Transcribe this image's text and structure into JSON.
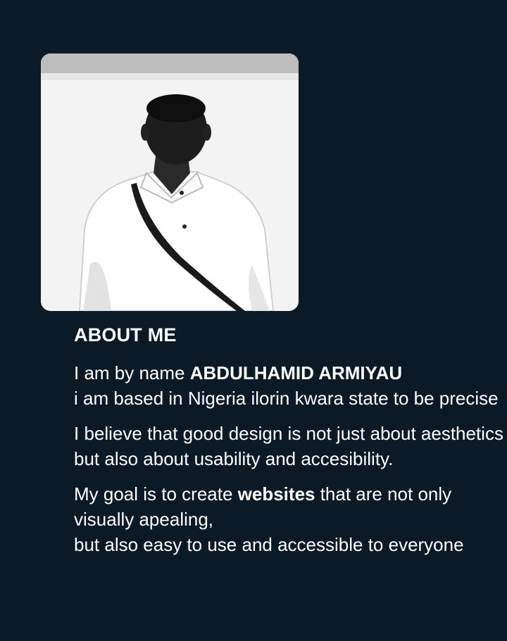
{
  "about": {
    "heading": "ABOUT ME",
    "intro_prefix": "I am by name ",
    "name": "ABDULHAMID ARMIYAU",
    "location": "i am based in Nigeria ilorin kwara state to be precise",
    "belief": "I believe that good design is not just about aesthetics but also about usability and accesibility.",
    "goal_prefix": "My goal is to create ",
    "goal_bold": "websites",
    "goal_rest_line1": " that are not only visually apealing,",
    "goal_rest_line2": "but also easy to use and accessible to everyone"
  },
  "colors": {
    "background": "#0b1a27",
    "text": "#ffffff"
  }
}
